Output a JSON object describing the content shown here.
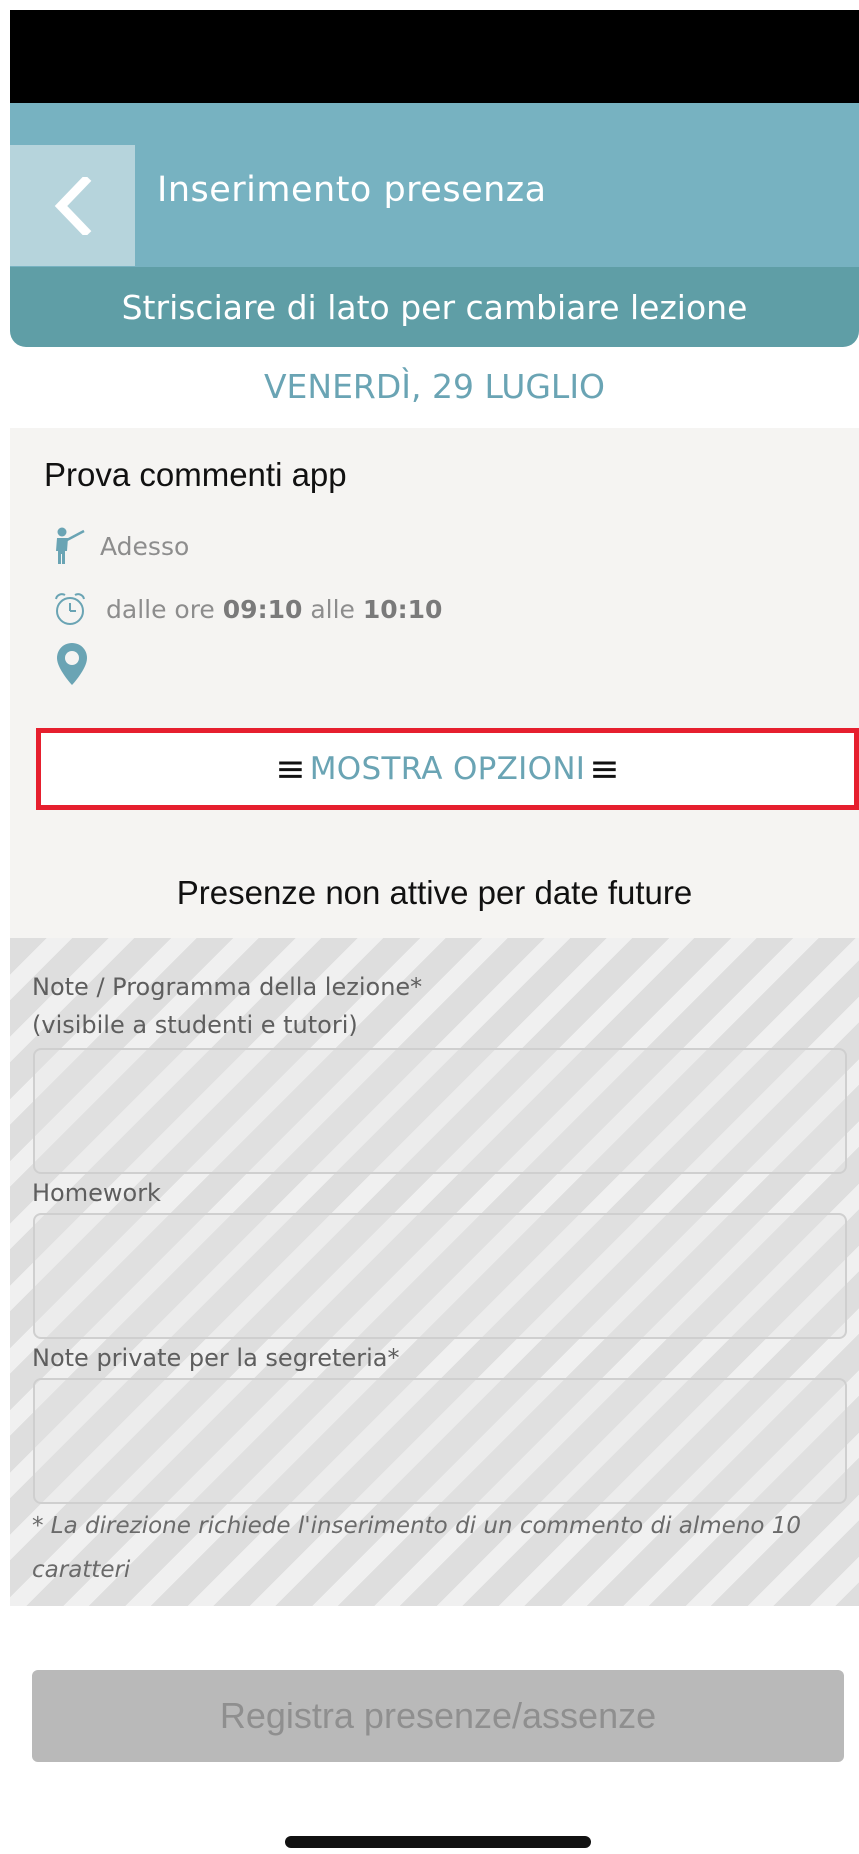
{
  "header": {
    "title": "Inserimento presenza",
    "subtitle": "Strisciare di lato per cambiare lezione"
  },
  "date": "VENERDÌ, 29 LUGLIO",
  "lesson": {
    "title": "Prova commenti app",
    "status": "Adesso",
    "time_prefix": "dalle ore",
    "start": "09:10",
    "time_mid": "alle",
    "end": "10:10"
  },
  "options_label": "MOSTRA OPZIONI",
  "inactive_message": "Presenze non attive per date future",
  "form": {
    "notes_label": "Note / Programma della lezione*",
    "notes_sublabel": "(visibile a studenti e tutori)",
    "homework_label": "Homework",
    "private_notes_label": "Note private per la segreteria*",
    "required_note": "* La direzione richiede l'inserimento di un commento di almeno 10 caratteri"
  },
  "submit_label": "Registra presenze/assenze",
  "icons": {
    "back": "chevron-left-icon",
    "teacher": "teacher-icon",
    "clock": "alarm-clock-icon",
    "location": "location-pin-icon",
    "menu": "hamburger-icon"
  },
  "colors": {
    "header": "#77b2c1",
    "subheader": "#5f9ea6",
    "accent": "#6aa4b4",
    "highlight_border": "#e61f2e",
    "button_disabled": "#b9b9b9"
  }
}
